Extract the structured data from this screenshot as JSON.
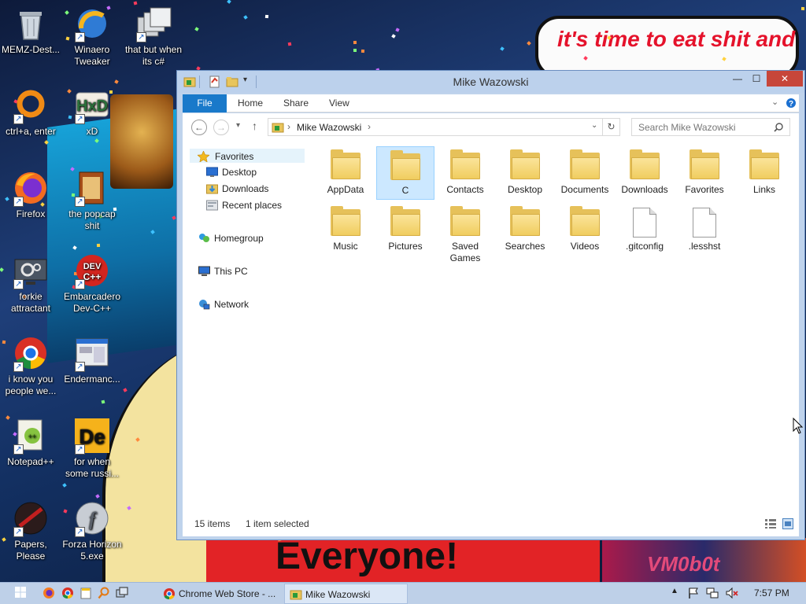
{
  "wallpaper": {
    "bubble_text": "it's time to eat shit and die and celebrate",
    "banner_text": "Everyone!",
    "corner_text": "VM0b0t"
  },
  "desktop_icons": [
    {
      "label": "MEMZ-Dest...",
      "icon": "recycle-bin-icon"
    },
    {
      "label": "Winaero Tweaker",
      "icon": "winaero-icon"
    },
    {
      "label": "that but when its c#",
      "icon": "stacked-windows-icon"
    },
    {
      "label": "ctrl+a, enter",
      "icon": "orange-ring-icon"
    },
    {
      "label": "xD",
      "icon": "hxd-icon"
    },
    {
      "label": "Firefox",
      "icon": "firefox-icon"
    },
    {
      "label": "the popcap shit",
      "icon": "popcap-icon"
    },
    {
      "label": "forkie attractant",
      "icon": "gear-monitor-icon"
    },
    {
      "label": "Embarcadero Dev-C++",
      "icon": "devcpp-icon"
    },
    {
      "label": "i know you people we...",
      "icon": "chrome-icon"
    },
    {
      "label": "Endermanc...",
      "icon": "window-app-icon"
    },
    {
      "label": "Notepad++",
      "icon": "notepadpp-icon"
    },
    {
      "label": "for when some russi...",
      "icon": "de-icon"
    },
    {
      "label": "Papers, Please",
      "icon": "papers-please-icon"
    },
    {
      "label": "Forza Horizon 5.exe",
      "icon": "flash-icon"
    }
  ],
  "window": {
    "title": "Mike Wazowski",
    "controls": {
      "minimize": "—",
      "maximize": "☐",
      "close": "✕"
    },
    "ribbon_tabs": [
      "File",
      "Home",
      "Share",
      "View"
    ],
    "address": {
      "crumb": "Mike Wazowski",
      "separator": "›"
    },
    "search_placeholder": "Search Mike Wazowski",
    "nav": {
      "favorites": "Favorites",
      "desktop": "Desktop",
      "downloads": "Downloads",
      "recent": "Recent places",
      "homegroup": "Homegroup",
      "thispc": "This PC",
      "network": "Network"
    },
    "items": [
      {
        "label": "AppData",
        "type": "folder",
        "accent": ""
      },
      {
        "label": "C",
        "type": "folder",
        "accent": "#d9dde6",
        "selected": true
      },
      {
        "label": "Contacts",
        "type": "folder",
        "accent": "#7aa6d6"
      },
      {
        "label": "Desktop",
        "type": "folder",
        "accent": "#2a6fd1"
      },
      {
        "label": "Documents",
        "type": "folder",
        "accent": "#f3f3f3"
      },
      {
        "label": "Downloads",
        "type": "folder",
        "accent": "#2f86d8"
      },
      {
        "label": "Favorites",
        "type": "folder",
        "accent": "#f4c518"
      },
      {
        "label": "Links",
        "type": "folder",
        "accent": "#2d8ad8"
      },
      {
        "label": "Music",
        "type": "folder",
        "accent": "#3a7cd0"
      },
      {
        "label": "Pictures",
        "type": "folder",
        "accent": "#4aa2d8"
      },
      {
        "label": "Saved Games",
        "type": "folder",
        "accent": "#5f6f80"
      },
      {
        "label": "Searches",
        "type": "folder",
        "accent": "#cfd8e3"
      },
      {
        "label": "Videos",
        "type": "folder",
        "accent": "#2f6a4a"
      },
      {
        "label": ".gitconfig",
        "type": "file",
        "accent": ""
      },
      {
        "label": ".lesshst",
        "type": "file",
        "accent": ""
      }
    ],
    "status": {
      "count": "15 items",
      "selection": "1 item selected"
    }
  },
  "taskbar": {
    "tasks": [
      {
        "label": "Chrome Web Store - ...",
        "icon": "chrome-icon",
        "active": false
      },
      {
        "label": "Mike Wazowski",
        "icon": "folder-icon",
        "active": true
      }
    ],
    "clock": "7:57 PM"
  }
}
